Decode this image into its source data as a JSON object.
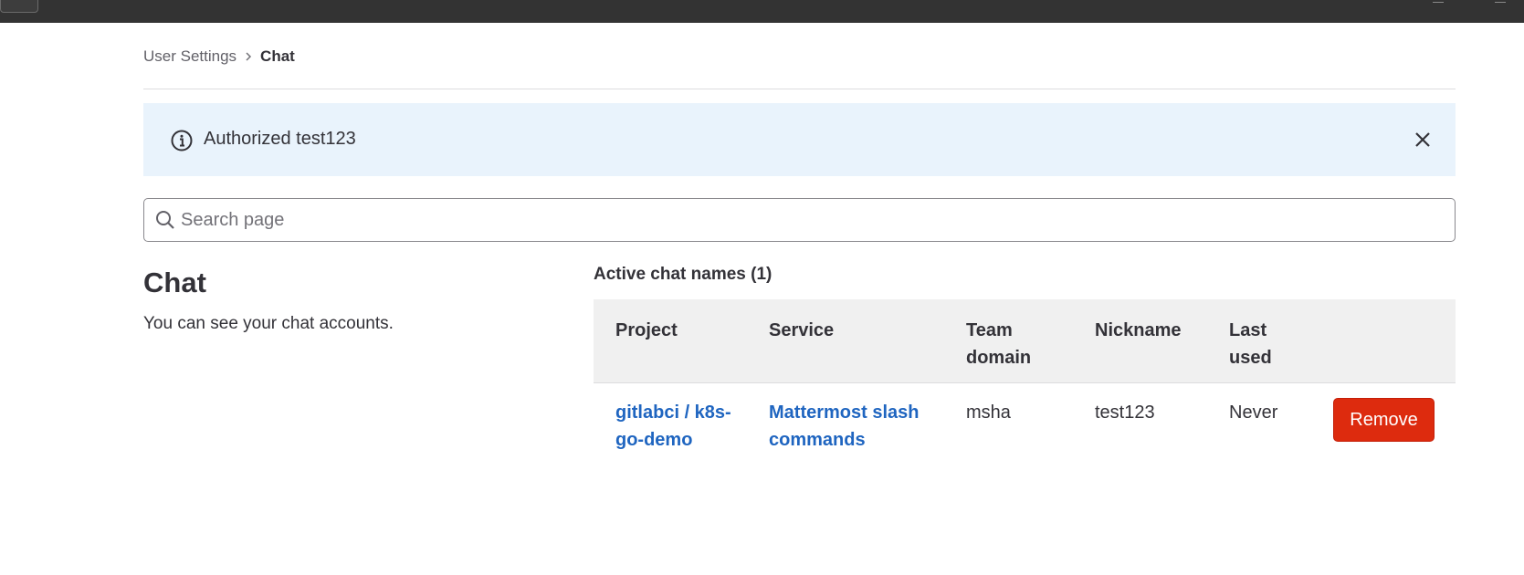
{
  "breadcrumb": {
    "parent": "User Settings",
    "current": "Chat"
  },
  "alert": {
    "message": "Authorized test123",
    "info_icon": "info-circle-icon",
    "close_icon": "close-icon",
    "background": "#e9f3fc"
  },
  "search": {
    "placeholder": "Search page",
    "value": "",
    "icon": "search-icon"
  },
  "section": {
    "title": "Chat",
    "description": "You can see your chat accounts."
  },
  "table": {
    "caption": "Active chat names (1)",
    "headers": {
      "project": "Project",
      "service": "Service",
      "team_domain": "Team domain",
      "nickname": "Nickname",
      "last_used": "Last used"
    },
    "rows": [
      {
        "project": "gitlabci / k8s-go-demo",
        "service": "Mattermost slash commands",
        "team_domain": "msha",
        "nickname": "test123",
        "last_used": "Never",
        "action": "Remove"
      }
    ]
  },
  "colors": {
    "link": "#1f65c0",
    "danger": "#dd2b0e",
    "topbar": "#333333"
  }
}
